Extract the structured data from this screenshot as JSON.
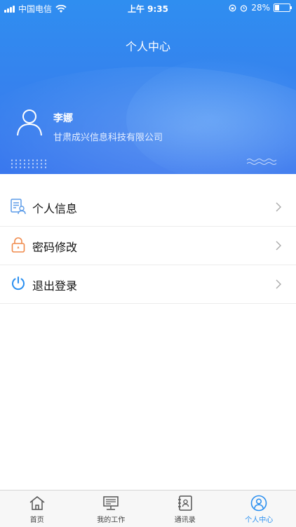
{
  "status_bar": {
    "carrier": "中国电信",
    "time": "上午 9:35",
    "battery": "28%",
    "battery_level": 0.28
  },
  "header": {
    "title": "个人中心"
  },
  "user": {
    "name": "李娜",
    "company": "甘肃成兴信息科技有限公司"
  },
  "menu": [
    {
      "label": "个人信息",
      "icon": "profile-card-icon"
    },
    {
      "label": "密码修改",
      "icon": "lock-icon"
    },
    {
      "label": "退出登录",
      "icon": "power-icon"
    }
  ],
  "tabs": [
    {
      "label": "首页",
      "icon": "home-icon",
      "active": false
    },
    {
      "label": "我的工作",
      "icon": "computer-icon",
      "active": false
    },
    {
      "label": "通讯录",
      "icon": "contacts-icon",
      "active": false
    },
    {
      "label": "个人中心",
      "icon": "user-circle-icon",
      "active": true
    }
  ],
  "colors": {
    "header_blue": "#3583ee",
    "accent": "#2a8ff0",
    "lock_orange": "#f08a4b"
  }
}
